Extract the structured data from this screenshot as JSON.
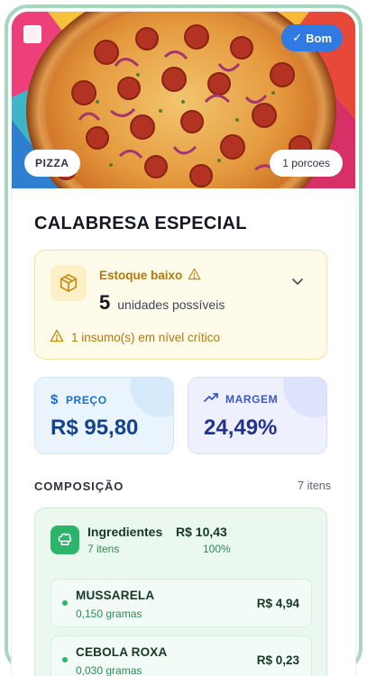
{
  "hero": {
    "badge_label": "Bom",
    "badge_check": "✓",
    "category_label": "PIZZA",
    "portion_label": "1 porcoes"
  },
  "product": {
    "name": "CALABRESA ESPECIAL"
  },
  "stock": {
    "status_label": "Estoque baixo",
    "available_count": "5",
    "available_unit": "unidades possíveis",
    "critical_warning": "1 insumo(s) em nível crítico",
    "colors": {
      "text": "#b3790a",
      "background": "#fefbea"
    }
  },
  "metrics": {
    "price": {
      "label": "PREÇO",
      "icon": "dollar-icon",
      "value": "R$ 95,80"
    },
    "margin": {
      "label": "MARGEM",
      "icon": "trending-up-icon",
      "value": "24,49%"
    }
  },
  "composition": {
    "title": "COMPOSIÇÃO",
    "count_label": "7 itens",
    "groups": [
      {
        "name": "Ingredientes",
        "icon": "chef-hat-icon",
        "items_count": "7 itens",
        "total": "R$ 10,43",
        "percent": "100%",
        "items": [
          {
            "name": "MUSSARELA",
            "quantity": "0,150 gramas",
            "price": "R$ 4,94"
          },
          {
            "name": "CEBOLA ROXA",
            "quantity": "0,030 gramas",
            "price": "R$ 0,23"
          }
        ]
      }
    ]
  },
  "colors": {
    "accent_blue": "#2f7be3",
    "accent_green": "#2ab56a",
    "frame_border": "#a9d6be"
  }
}
